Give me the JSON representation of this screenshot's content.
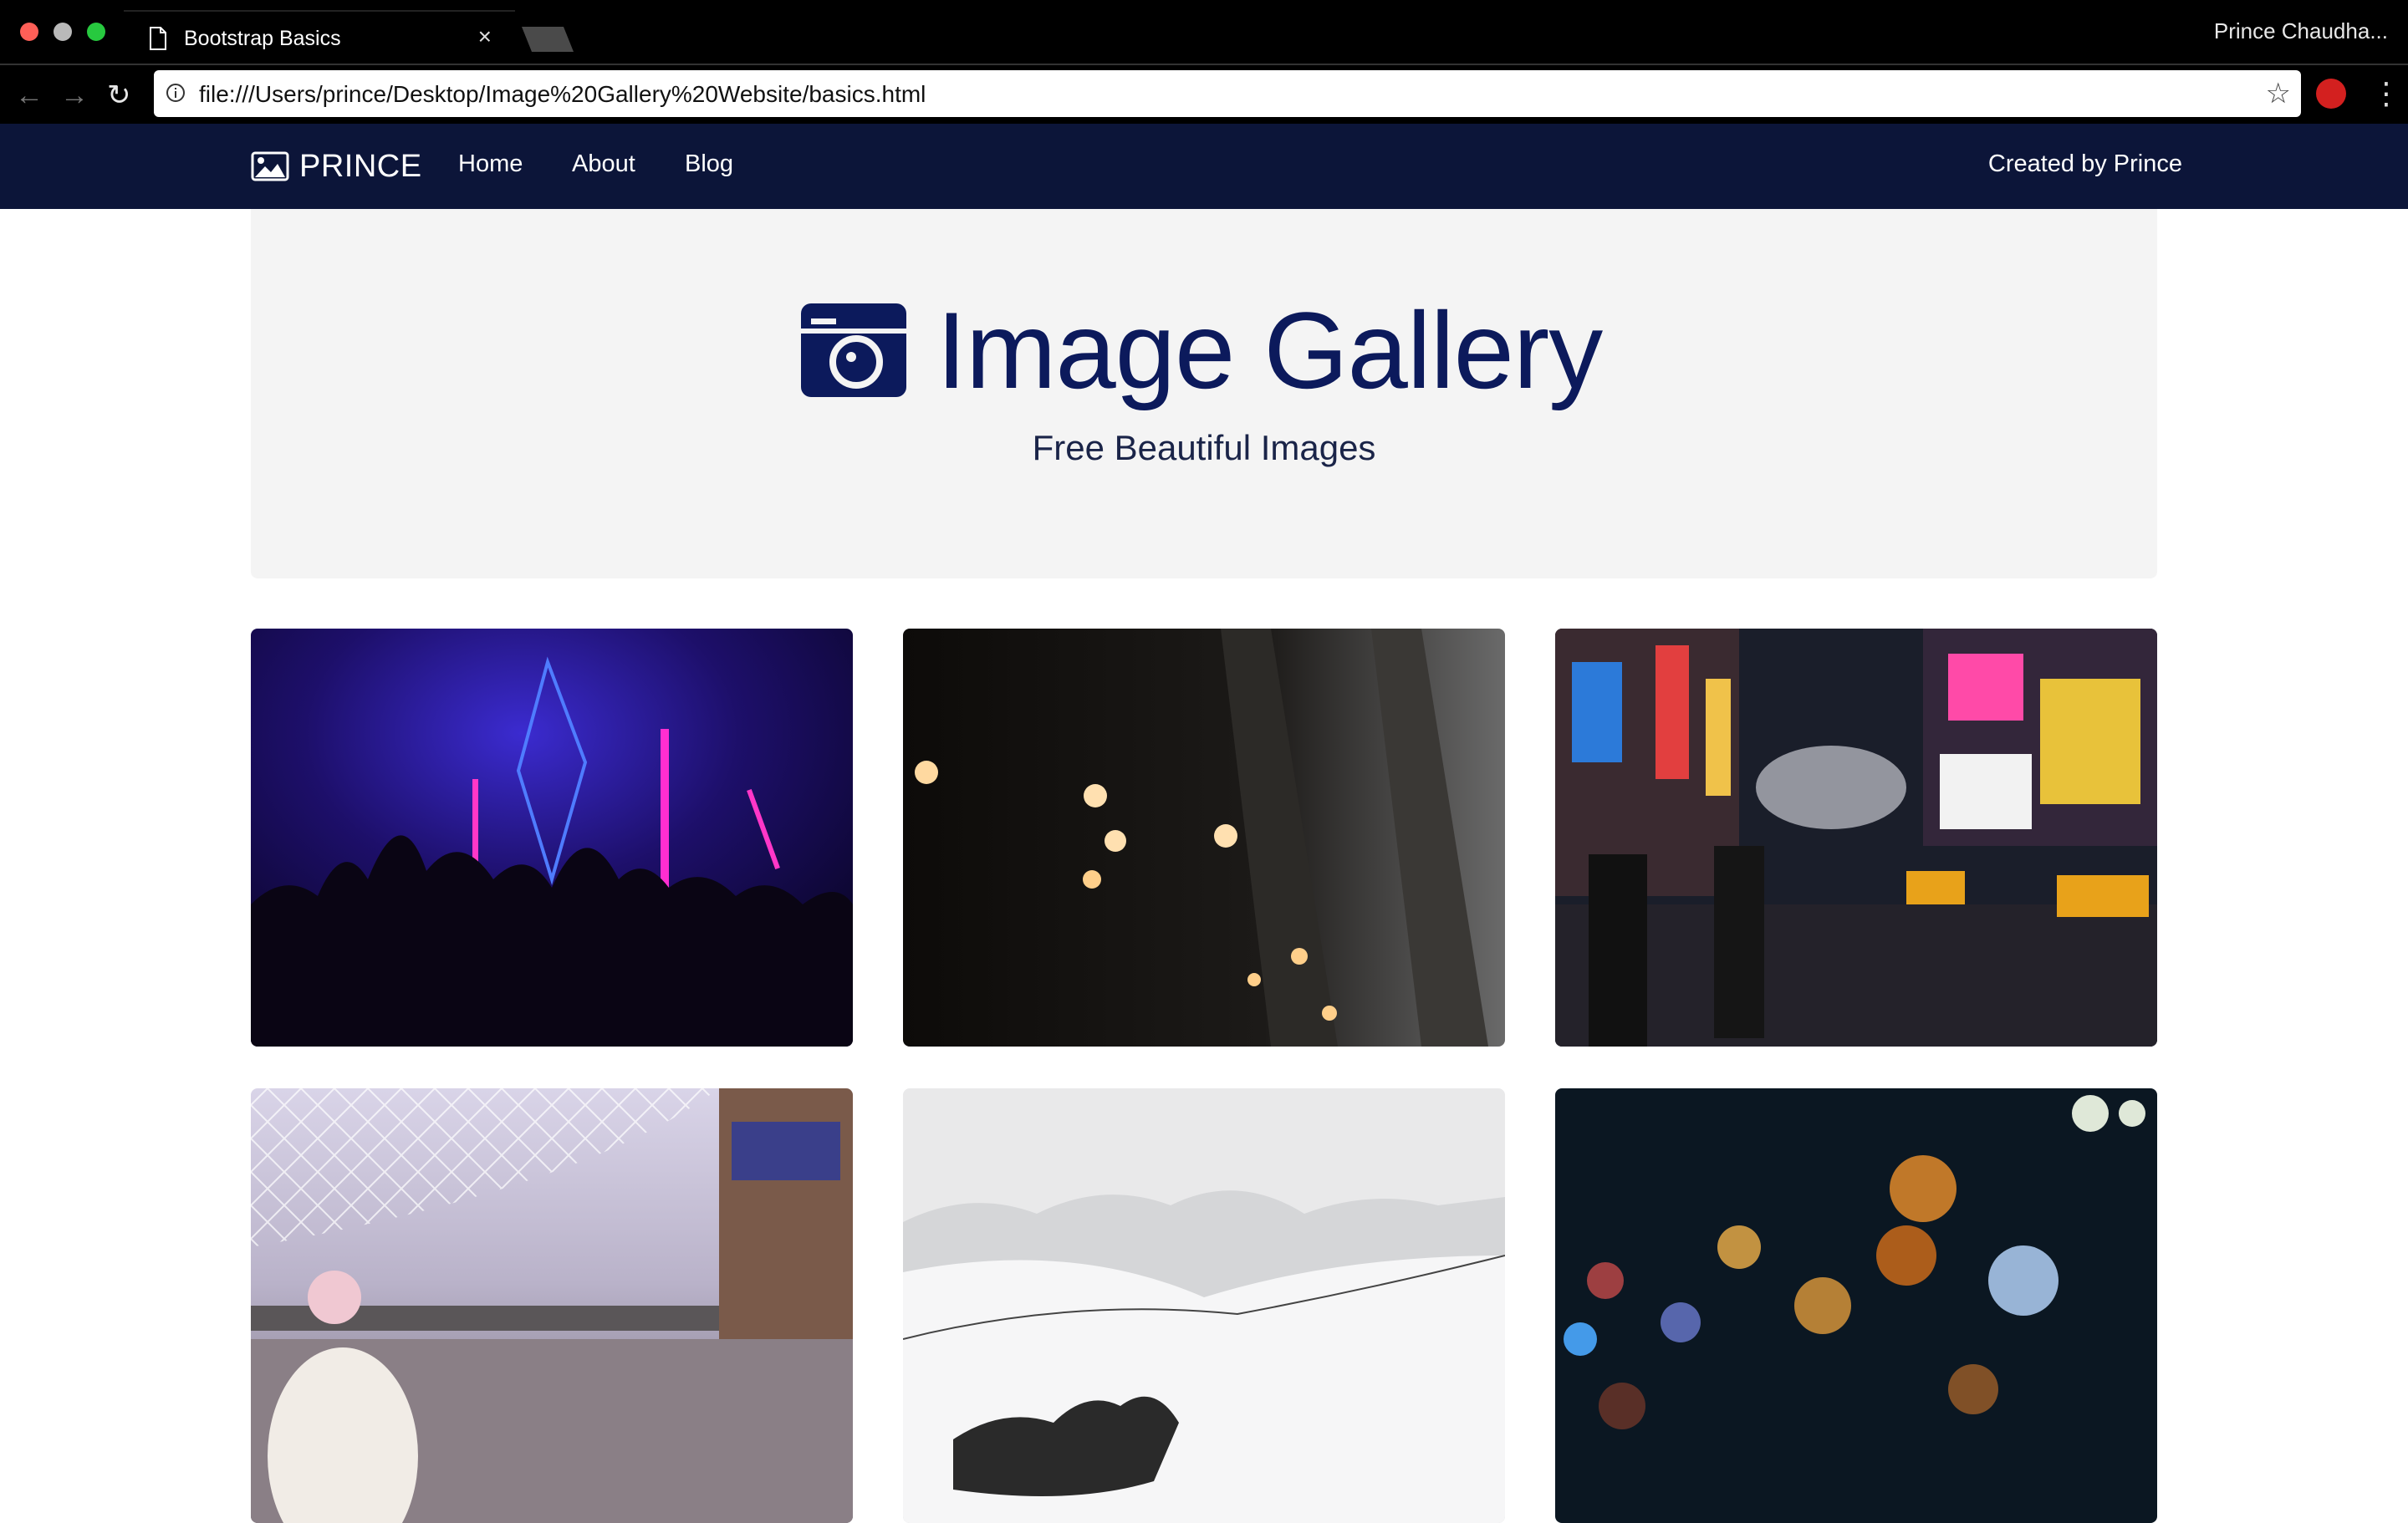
{
  "browser": {
    "tab_title": "Bootstrap Basics",
    "tab_close": "×",
    "profile_name": "Prince Chaudha...",
    "url": "file:///Users/prince/Desktop/Image%20Gallery%20Website/basics.html",
    "icons": [
      "document-icon",
      "back-arrow-icon",
      "forward-arrow-icon",
      "reload-icon",
      "info-icon",
      "star-icon",
      "extension-icon",
      "menu-dots-icon"
    ]
  },
  "navbar": {
    "brand": "PRINCE",
    "links": [
      "Home",
      "About",
      "Blog"
    ],
    "right_text": "Created by Prince",
    "background": "#0c1539"
  },
  "jumbotron": {
    "title": "Image Gallery",
    "subtitle": "Free Beautiful Images",
    "accent": "#0c1a5c"
  },
  "gallery": [
    {
      "subject": "concert crowd with neon lights"
    },
    {
      "subject": "blurred bokeh lights in dark bar"
    },
    {
      "subject": "Times Square at night"
    },
    {
      "subject": "King's Cross station concourse"
    },
    {
      "subject": "snowy mountain ridge"
    },
    {
      "subject": "colorful city bokeh at night"
    }
  ]
}
